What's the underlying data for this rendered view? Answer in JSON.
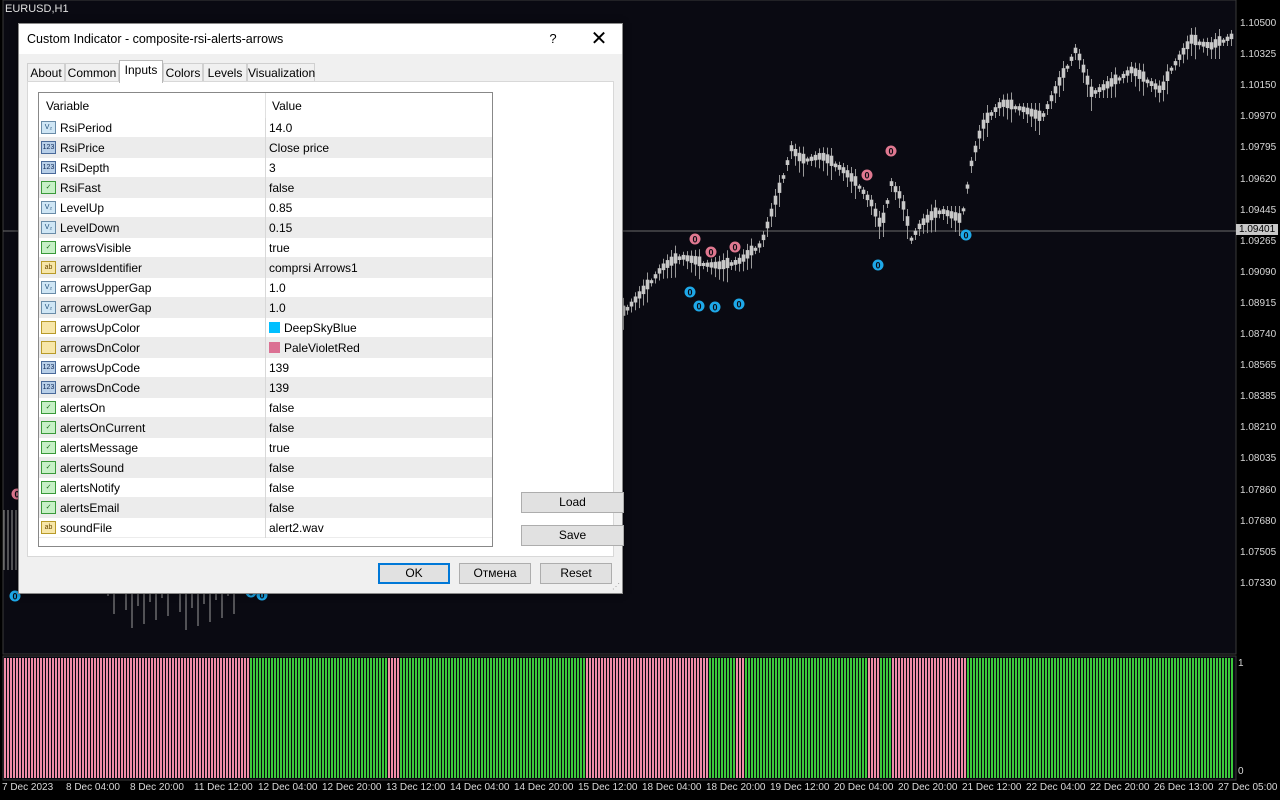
{
  "chart": {
    "symbol": "EURUSD,H1",
    "price_ticks": [
      "1.10500",
      "1.10325",
      "1.10150",
      "1.09970",
      "1.09795",
      "1.09620",
      "1.09445",
      "1.09265",
      "1.09090",
      "1.08915",
      "1.08740",
      "1.08565",
      "1.08385",
      "1.08210",
      "1.08035",
      "1.07860",
      "1.07680",
      "1.07505",
      "1.07330"
    ],
    "current_price": "1.09401",
    "time_ticks": [
      "7 Dec 2023",
      "8 Dec 04:00",
      "8 Dec 20:00",
      "11 Dec 12:00",
      "12 Dec 04:00",
      "12 Dec 20:00",
      "13 Dec 12:00",
      "14 Dec 04:00",
      "14 Dec 20:00",
      "15 Dec 12:00",
      "18 Dec 04:00",
      "18 Dec 20:00",
      "19 Dec 12:00",
      "20 Dec 04:00",
      "20 Dec 20:00",
      "21 Dec 12:00",
      "22 Dec 04:00",
      "22 Dec 20:00",
      "26 Dec 13:00",
      "27 Dec 05:00"
    ],
    "subwindow_max": "1",
    "subwindow_min": "0",
    "arrow_glyph": "0",
    "up_color": "#1ea8e8",
    "down_color": "#e07890",
    "bull_color": "#3cc83c",
    "bear_color": "#f08ca8"
  },
  "dialog": {
    "title": "Custom Indicator - composite-rsi-alerts-arrows",
    "help": "?",
    "close": "✕",
    "tabs": [
      "About",
      "Common",
      "Inputs",
      "Colors",
      "Levels",
      "Visualization"
    ],
    "active_tab": "Inputs",
    "grid_header": {
      "variable": "Variable",
      "value": "Value"
    },
    "rows": [
      {
        "type": "dbl",
        "icon": "V₂",
        "name": "RsiPeriod",
        "value": "14.0"
      },
      {
        "type": "int",
        "icon": "123",
        "name": "RsiPrice",
        "value": "Close price"
      },
      {
        "type": "int",
        "icon": "123",
        "name": "RsiDepth",
        "value": "3"
      },
      {
        "type": "bool",
        "icon": "✓",
        "name": "RsiFast",
        "value": "false"
      },
      {
        "type": "dbl",
        "icon": "V₂",
        "name": "LevelUp",
        "value": "0.85"
      },
      {
        "type": "dbl",
        "icon": "V₂",
        "name": "LevelDown",
        "value": "0.15"
      },
      {
        "type": "bool",
        "icon": "✓",
        "name": "arrowsVisible",
        "value": "true"
      },
      {
        "type": "str",
        "icon": "ab",
        "name": "arrowsIdentifier",
        "value": "comprsi Arrows1"
      },
      {
        "type": "dbl",
        "icon": "V₂",
        "name": "arrowsUpperGap",
        "value": "1.0"
      },
      {
        "type": "dbl",
        "icon": "V₂",
        "name": "arrowsLowerGap",
        "value": "1.0"
      },
      {
        "type": "col",
        "icon": "",
        "name": "arrowsUpColor",
        "value": "DeepSkyBlue",
        "swatch": "#00bfff"
      },
      {
        "type": "col",
        "icon": "",
        "name": "arrowsDnColor",
        "value": "PaleVioletRed",
        "swatch": "#db7093"
      },
      {
        "type": "int",
        "icon": "123",
        "name": "arrowsUpCode",
        "value": "139"
      },
      {
        "type": "int",
        "icon": "123",
        "name": "arrowsDnCode",
        "value": "139"
      },
      {
        "type": "bool",
        "icon": "✓",
        "name": "alertsOn",
        "value": "false"
      },
      {
        "type": "bool",
        "icon": "✓",
        "name": "alertsOnCurrent",
        "value": "false"
      },
      {
        "type": "bool",
        "icon": "✓",
        "name": "alertsMessage",
        "value": "true"
      },
      {
        "type": "bool",
        "icon": "✓",
        "name": "alertsSound",
        "value": "false"
      },
      {
        "type": "bool",
        "icon": "✓",
        "name": "alertsNotify",
        "value": "false"
      },
      {
        "type": "bool",
        "icon": "✓",
        "name": "alertsEmail",
        "value": "false"
      },
      {
        "type": "str",
        "icon": "ab",
        "name": "soundFile",
        "value": "alert2.wav"
      }
    ],
    "buttons": {
      "load": "Load",
      "save": "Save",
      "ok": "OK",
      "cancel": "Отмена",
      "reset": "Reset"
    }
  }
}
